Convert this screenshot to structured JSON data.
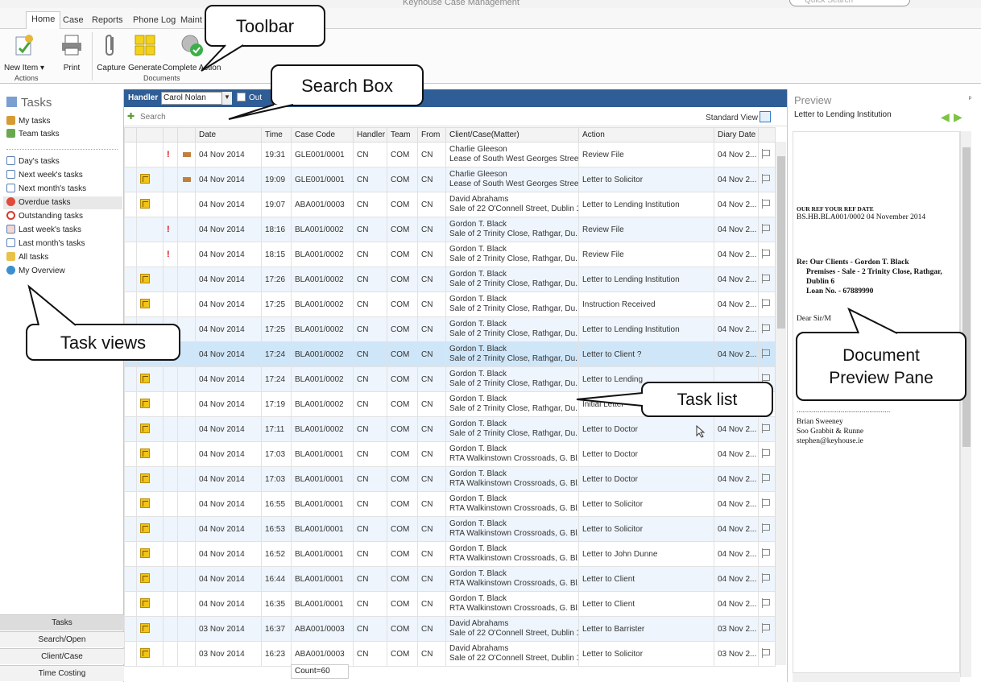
{
  "window": {
    "title": "Keyhouse Case Management",
    "quick_search_placeholder": "Quick Search"
  },
  "ribbon_tabs": [
    "Home",
    "Case",
    "Reports",
    "Phone Log",
    "Maint"
  ],
  "ribbon": {
    "new_item": "New Item ▾",
    "print": "Print",
    "capture": "Capture",
    "generate": "Generate",
    "complete_action": "Complete Action",
    "group_actions": "Actions",
    "group_documents": "Documents"
  },
  "left_nav": {
    "header": "Tasks",
    "items_top": [
      "My tasks",
      "Team tasks"
    ],
    "items_views": [
      "Day's tasks",
      "Next week's tasks",
      "Next month's tasks",
      "Overdue tasks",
      "Outstanding tasks",
      "Last week's tasks",
      "Last month's tasks",
      "All tasks",
      "My Overview"
    ],
    "selected": "Overdue tasks",
    "bottom": [
      "Tasks",
      "Search/Open",
      "Client/Case",
      "Time Costing"
    ]
  },
  "handler_bar": {
    "label": "Handler",
    "value": "Carol Nolan",
    "checkbox_label": "Out"
  },
  "search": {
    "placeholder": "Search",
    "standard_view": "Standard View"
  },
  "columns": [
    "",
    "",
    "",
    "",
    "Date",
    "Time",
    "Case Code",
    "Handler",
    "Team",
    "From",
    "Client/Case(Matter)",
    "Action",
    "Diary Date",
    ""
  ],
  "rows": [
    {
      "doc": false,
      "excl": true,
      "flag": true,
      "date": "04 Nov 2014",
      "time": "19:31",
      "code": "GLE001/0001",
      "handler": "CN",
      "team": "COM",
      "from": "CN",
      "client": "Charlie Gleeson",
      "matter": "Lease of South West Georges Street",
      "action": "Review File",
      "diary": "04 Nov 2..."
    },
    {
      "doc": true,
      "excl": false,
      "flag": true,
      "date": "04 Nov 2014",
      "time": "19:09",
      "code": "GLE001/0001",
      "handler": "CN",
      "team": "COM",
      "from": "CN",
      "client": "Charlie Gleeson",
      "matter": "Lease of South West Georges Street",
      "action": "Letter to Solicitor",
      "diary": "04 Nov 2..."
    },
    {
      "doc": true,
      "excl": false,
      "flag": false,
      "date": "04 Nov 2014",
      "time": "19:07",
      "code": "ABA001/0003",
      "handler": "CN",
      "team": "COM",
      "from": "CN",
      "client": "David Abrahams",
      "matter": "Sale of 22 O'Connell Street, Dublin 1",
      "action": "Letter to Lending Institution",
      "diary": "04 Nov 2..."
    },
    {
      "doc": false,
      "excl": true,
      "flag": false,
      "date": "04 Nov 2014",
      "time": "18:16",
      "code": "BLA001/0002",
      "handler": "CN",
      "team": "COM",
      "from": "CN",
      "client": "Gordon T. Black",
      "matter": "Sale of 2 Trinity Close, Rathgar, Du...",
      "action": "Review File",
      "diary": "04 Nov 2..."
    },
    {
      "doc": false,
      "excl": true,
      "flag": false,
      "date": "04 Nov 2014",
      "time": "18:15",
      "code": "BLA001/0002",
      "handler": "CN",
      "team": "COM",
      "from": "CN",
      "client": "Gordon T. Black",
      "matter": "Sale of 2 Trinity Close, Rathgar, Du...",
      "action": "Review File",
      "diary": "04 Nov 2..."
    },
    {
      "doc": true,
      "excl": false,
      "flag": false,
      "date": "04 Nov 2014",
      "time": "17:26",
      "code": "BLA001/0002",
      "handler": "CN",
      "team": "COM",
      "from": "CN",
      "client": "Gordon T. Black",
      "matter": "Sale of 2 Trinity Close, Rathgar, Du...",
      "action": "Letter to Lending Institution",
      "diary": "04 Nov 2..."
    },
    {
      "doc": true,
      "excl": false,
      "flag": false,
      "date": "04 Nov 2014",
      "time": "17:25",
      "code": "BLA001/0002",
      "handler": "CN",
      "team": "COM",
      "from": "CN",
      "client": "Gordon T. Black",
      "matter": "Sale of 2 Trinity Close, Rathgar, Du...",
      "action": "Instruction Received",
      "diary": "04 Nov 2..."
    },
    {
      "doc": false,
      "excl": false,
      "flag": false,
      "date": "04 Nov 2014",
      "time": "17:25",
      "code": "BLA001/0002",
      "handler": "CN",
      "team": "COM",
      "from": "CN",
      "client": "Gordon T. Black",
      "matter": "Sale of 2 Trinity Close, Rathgar, Du...",
      "action": "Letter to Lending Institution",
      "diary": "04 Nov 2..."
    },
    {
      "doc": false,
      "excl": false,
      "flag": false,
      "date": "04 Nov 2014",
      "time": "17:24",
      "code": "BLA001/0002",
      "handler": "CN",
      "team": "COM",
      "from": "CN",
      "client": "Gordon T. Black",
      "matter": "Sale of 2 Trinity Close, Rathgar, Du...",
      "action": "Letter to Client ?",
      "diary": "04 Nov 2...",
      "selected": true
    },
    {
      "doc": true,
      "excl": false,
      "flag": false,
      "date": "04 Nov 2014",
      "time": "17:24",
      "code": "BLA001/0002",
      "handler": "CN",
      "team": "COM",
      "from": "CN",
      "client": "Gordon T. Black",
      "matter": "Sale of 2 Trinity Close, Rathgar, Du...",
      "action": "Letter to Lending",
      "diary": ""
    },
    {
      "doc": true,
      "excl": false,
      "flag": false,
      "date": "04 Nov 2014",
      "time": "17:19",
      "code": "BLA001/0002",
      "handler": "CN",
      "team": "COM",
      "from": "CN",
      "client": "Gordon T. Black",
      "matter": "Sale of 2 Trinity Close, Rathgar, Du...",
      "action": "Initial Letter",
      "diary": ""
    },
    {
      "doc": true,
      "excl": false,
      "flag": false,
      "date": "04 Nov 2014",
      "time": "17:11",
      "code": "BLA001/0002",
      "handler": "CN",
      "team": "COM",
      "from": "CN",
      "client": "Gordon T. Black",
      "matter": "Sale of 2 Trinity Close, Rathgar, Du...",
      "action": "Letter to Doctor",
      "diary": "04 Nov 2..."
    },
    {
      "doc": true,
      "excl": false,
      "flag": false,
      "date": "04 Nov 2014",
      "time": "17:03",
      "code": "BLA001/0001",
      "handler": "CN",
      "team": "COM",
      "from": "CN",
      "client": "Gordon T. Black",
      "matter": "RTA Walkinstown Crossroads, G. Bl...",
      "action": "Letter to Doctor",
      "diary": "04 Nov 2..."
    },
    {
      "doc": true,
      "excl": false,
      "flag": false,
      "date": "04 Nov 2014",
      "time": "17:03",
      "code": "BLA001/0001",
      "handler": "CN",
      "team": "COM",
      "from": "CN",
      "client": "Gordon T. Black",
      "matter": "RTA Walkinstown Crossroads, G. Bl...",
      "action": "Letter to Doctor",
      "diary": "04 Nov 2..."
    },
    {
      "doc": true,
      "excl": false,
      "flag": false,
      "date": "04 Nov 2014",
      "time": "16:55",
      "code": "BLA001/0001",
      "handler": "CN",
      "team": "COM",
      "from": "CN",
      "client": "Gordon T. Black",
      "matter": "RTA Walkinstown Crossroads, G. Bl...",
      "action": "Letter to Solicitor",
      "diary": "04 Nov 2..."
    },
    {
      "doc": true,
      "excl": false,
      "flag": false,
      "date": "04 Nov 2014",
      "time": "16:53",
      "code": "BLA001/0001",
      "handler": "CN",
      "team": "COM",
      "from": "CN",
      "client": "Gordon T. Black",
      "matter": "RTA Walkinstown Crossroads, G. Bl...",
      "action": "Letter to Solicitor",
      "diary": "04 Nov 2..."
    },
    {
      "doc": true,
      "excl": false,
      "flag": false,
      "date": "04 Nov 2014",
      "time": "16:52",
      "code": "BLA001/0001",
      "handler": "CN",
      "team": "COM",
      "from": "CN",
      "client": "Gordon T. Black",
      "matter": "RTA Walkinstown Crossroads, G. Bl...",
      "action": "Letter to John Dunne",
      "diary": "04 Nov 2..."
    },
    {
      "doc": true,
      "excl": false,
      "flag": false,
      "date": "04 Nov 2014",
      "time": "16:44",
      "code": "BLA001/0001",
      "handler": "CN",
      "team": "COM",
      "from": "CN",
      "client": "Gordon T. Black",
      "matter": "RTA Walkinstown Crossroads, G. Bl...",
      "action": "Letter to Client",
      "diary": "04 Nov 2..."
    },
    {
      "doc": true,
      "excl": false,
      "flag": false,
      "date": "04 Nov 2014",
      "time": "16:35",
      "code": "BLA001/0001",
      "handler": "CN",
      "team": "COM",
      "from": "CN",
      "client": "Gordon T. Black",
      "matter": "RTA Walkinstown Crossroads, G. Bl...",
      "action": "Letter to Client",
      "diary": "04 Nov 2..."
    },
    {
      "doc": true,
      "excl": false,
      "flag": false,
      "date": "03 Nov 2014",
      "time": "16:37",
      "code": "ABA001/0003",
      "handler": "CN",
      "team": "COM",
      "from": "CN",
      "client": "David Abrahams",
      "matter": "Sale of 22 O'Connell Street, Dublin 1",
      "action": "Letter to Barrister",
      "diary": "03 Nov 2..."
    },
    {
      "doc": true,
      "excl": false,
      "flag": false,
      "date": "03 Nov 2014",
      "time": "16:23",
      "code": "ABA001/0003",
      "handler": "CN",
      "team": "COM",
      "from": "CN",
      "client": "David Abrahams",
      "matter": "Sale of 22 O'Connell Street, Dublin 1",
      "action": "Letter to Solicitor",
      "diary": "03 Nov 2..."
    }
  ],
  "count": "Count=60",
  "preview": {
    "title": "Preview",
    "doc_title": "Letter to Lending Institution",
    "ref_header": "OUR REF    YOUR REF        DATE",
    "ref_line": "BS.HB.BLA001/0002        04 November 2014",
    "re_line1": "Re:   Our Clients -  Gordon T. Black",
    "re_line2": "Premises -   Sale - 2 Trinity Close, Rathgar, Dublin 6",
    "re_line3": "Loan No. -    67889990",
    "dear": "Dear Sir/M",
    "signoff": ".................................................",
    "sig_name": "Brian Sweeney",
    "sig_firm": "Soo Grabbit & Runne",
    "sig_email": "stephen@keyhouse.ie"
  },
  "callouts": {
    "toolbar": "Toolbar",
    "search_box": "Search Box",
    "task_views": "Task views",
    "task_list": "Task list",
    "preview_pane_1": "Document",
    "preview_pane_2": "Preview Pane"
  },
  "colors": {
    "handler_bar": "#2f5d95",
    "row_alt": "#eef5fc",
    "row_selected": "#cfe6f8",
    "nav_arrows": "#7cc444"
  }
}
